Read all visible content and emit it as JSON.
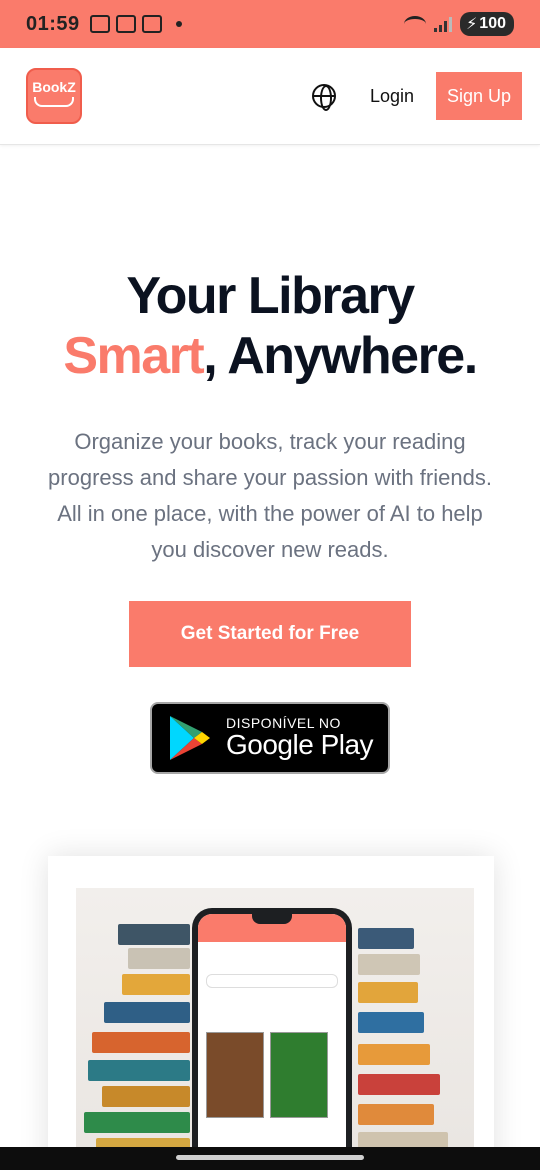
{
  "status_bar": {
    "time": "01:59",
    "battery": "100"
  },
  "header": {
    "logo_text": "BookZ",
    "login_label": "Login",
    "signup_label": "Sign Up"
  },
  "hero": {
    "title_line1": "Your Library",
    "title_accent": "Smart",
    "title_rest": ", Anywhere.",
    "description": "Organize your books, track your reading progress and share your passion with friends. All in one place, with the power of AI to help you discover new reads.",
    "cta_label": "Get Started for Free"
  },
  "google_play": {
    "top_text": "DISPONÍVEL NO",
    "bottom_text": "Google Play"
  },
  "colors": {
    "accent": "#fa7b6b",
    "title": "#0b1220",
    "muted": "#6b7280"
  }
}
